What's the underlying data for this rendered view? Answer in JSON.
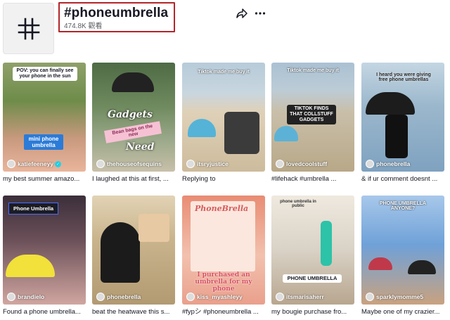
{
  "header": {
    "hashtag": "#phoneumbrella",
    "views": "474.8K 觀看",
    "icon": "hashtag-icon",
    "share_icon": "share-icon",
    "more_icon": "more-icon"
  },
  "videos": [
    {
      "creator": "katiefeeneyy",
      "verified": true,
      "caption": "my best summer amazo...",
      "overlays": [
        "POV: you can finally see your phone in the sun",
        "mini phone umbrella"
      ],
      "colors": [
        "#6e8c4a",
        "#b7c7d8",
        "#e9b59b"
      ]
    },
    {
      "creator": "thehouseofsequins",
      "verified": false,
      "caption": "I laughed at this at first, ...",
      "overlays": [
        "Gadgets",
        "Bean bags on the new",
        "Need"
      ],
      "colors": [
        "#5f7d52",
        "#9aa889",
        "#262626"
      ]
    },
    {
      "creator": "itsryjustice",
      "verified": false,
      "caption": "Replying to",
      "overlays": [
        "Tiktok made me buy it"
      ],
      "colors": [
        "#dfd1b8",
        "#b7cbd9",
        "#3b3b3b"
      ]
    },
    {
      "creator": "lovedcoolstuff",
      "verified": false,
      "caption": "#lifehack #umbrella ...",
      "overlays": [
        "Tiktok made me buy it",
        "TIKTOK FINDS THAT COLLSTUFF GADGETS"
      ],
      "colors": [
        "#c9bfa9",
        "#aac1d3",
        "#2a2a2a"
      ]
    },
    {
      "creator": "phonebrella",
      "verified": false,
      "caption": "& if ur comment doesnt ...",
      "overlays": [
        "I heard you were giving free phone umbrellas"
      ],
      "colors": [
        "#7fa2c0",
        "#c4d6e3",
        "#1c1c1c"
      ]
    },
    {
      "creator": "brandielo",
      "verified": false,
      "caption": "Found a phone umbrella...",
      "overlays": [
        "Phone Umbrella"
      ],
      "colors": [
        "#3b2f3a",
        "#d0a6a0",
        "#f2e13a"
      ]
    },
    {
      "creator": "phonebrella",
      "verified": false,
      "caption": "beat the heatwave this s...",
      "overlays": [],
      "colors": [
        "#b29a72",
        "#e2d3b5",
        "#1b1b1b"
      ]
    },
    {
      "creator": "kiss_myashleyy",
      "verified": false,
      "caption": "#fypシ #phoneumbrella ...",
      "overlays": [
        "PhoneBrella",
        "I purchased an umbrella for my phone"
      ],
      "colors": [
        "#e98c74",
        "#f2c1ae",
        "#ffffff"
      ]
    },
    {
      "creator": "itsmarisaherr",
      "verified": false,
      "caption": "my bougie purchase fro...",
      "overlays": [
        "phone umbrella in public",
        "PHONE UMBRELLA"
      ],
      "colors": [
        "#d9d2c6",
        "#efe9df",
        "#2cc3a8"
      ]
    },
    {
      "creator": "sparklymomme5",
      "verified": false,
      "caption": "Maybe one of my crazier...",
      "overlays": [
        "PHONE UMBRELLA ANYONE?"
      ],
      "colors": [
        "#6fa1d8",
        "#a8c8ea",
        "#c0394a"
      ]
    }
  ]
}
